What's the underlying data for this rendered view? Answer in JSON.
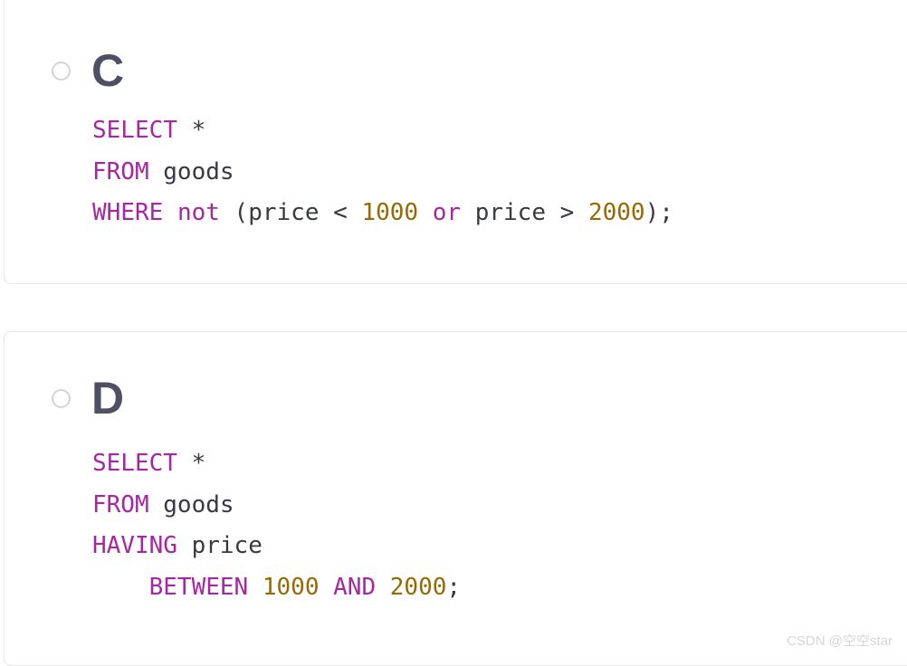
{
  "page": {
    "background_color": "#ffffff",
    "watermark": "CSDN @空空star"
  },
  "theme": {
    "keyword_color": "#a626a4",
    "number_color": "#986801",
    "plain_color": "#383a42",
    "letter_color": "#4e5166",
    "card_border_color": "#e6e6ec",
    "radio_border_color": "#d2d2dd",
    "watermark_color": "#d6d6dc"
  },
  "options": [
    {
      "id": "c",
      "letter": "C",
      "radio_icon": "radio-unchecked-icon",
      "selected": false,
      "code_lines": [
        [
          {
            "t": "SELECT",
            "k": "kw"
          },
          {
            "t": " *",
            "k": "plain"
          }
        ],
        [
          {
            "t": "FROM",
            "k": "kw"
          },
          {
            "t": " goods",
            "k": "plain"
          }
        ],
        [
          {
            "t": "WHERE",
            "k": "kw"
          },
          {
            "t": " ",
            "k": "plain"
          },
          {
            "t": "not",
            "k": "kw"
          },
          {
            "t": " (price < ",
            "k": "plain"
          },
          {
            "t": "1000",
            "k": "num"
          },
          {
            "t": " ",
            "k": "plain"
          },
          {
            "t": "or",
            "k": "kw"
          },
          {
            "t": " price > ",
            "k": "plain"
          },
          {
            "t": "2000",
            "k": "num"
          },
          {
            "t": ");",
            "k": "plain"
          }
        ]
      ],
      "code_text": "SELECT *\nFROM goods\nWHERE not (price < 1000 or price > 2000);"
    },
    {
      "id": "d",
      "letter": "D",
      "radio_icon": "radio-unchecked-icon",
      "selected": false,
      "code_lines": [
        [
          {
            "t": "SELECT",
            "k": "kw"
          },
          {
            "t": " *",
            "k": "plain"
          }
        ],
        [
          {
            "t": "FROM",
            "k": "kw"
          },
          {
            "t": " goods",
            "k": "plain"
          }
        ],
        [
          {
            "t": "HAVING",
            "k": "kw"
          },
          {
            "t": " price",
            "k": "plain"
          }
        ],
        [
          {
            "t": "    ",
            "k": "plain"
          },
          {
            "t": "BETWEEN",
            "k": "kw"
          },
          {
            "t": " ",
            "k": "plain"
          },
          {
            "t": "1000",
            "k": "num"
          },
          {
            "t": " ",
            "k": "plain"
          },
          {
            "t": "AND",
            "k": "kw"
          },
          {
            "t": " ",
            "k": "plain"
          },
          {
            "t": "2000",
            "k": "num"
          },
          {
            "t": ";",
            "k": "plain"
          }
        ]
      ],
      "code_text": "SELECT *\nFROM goods\nHAVING price\n    BETWEEN 1000 AND 2000;"
    }
  ]
}
